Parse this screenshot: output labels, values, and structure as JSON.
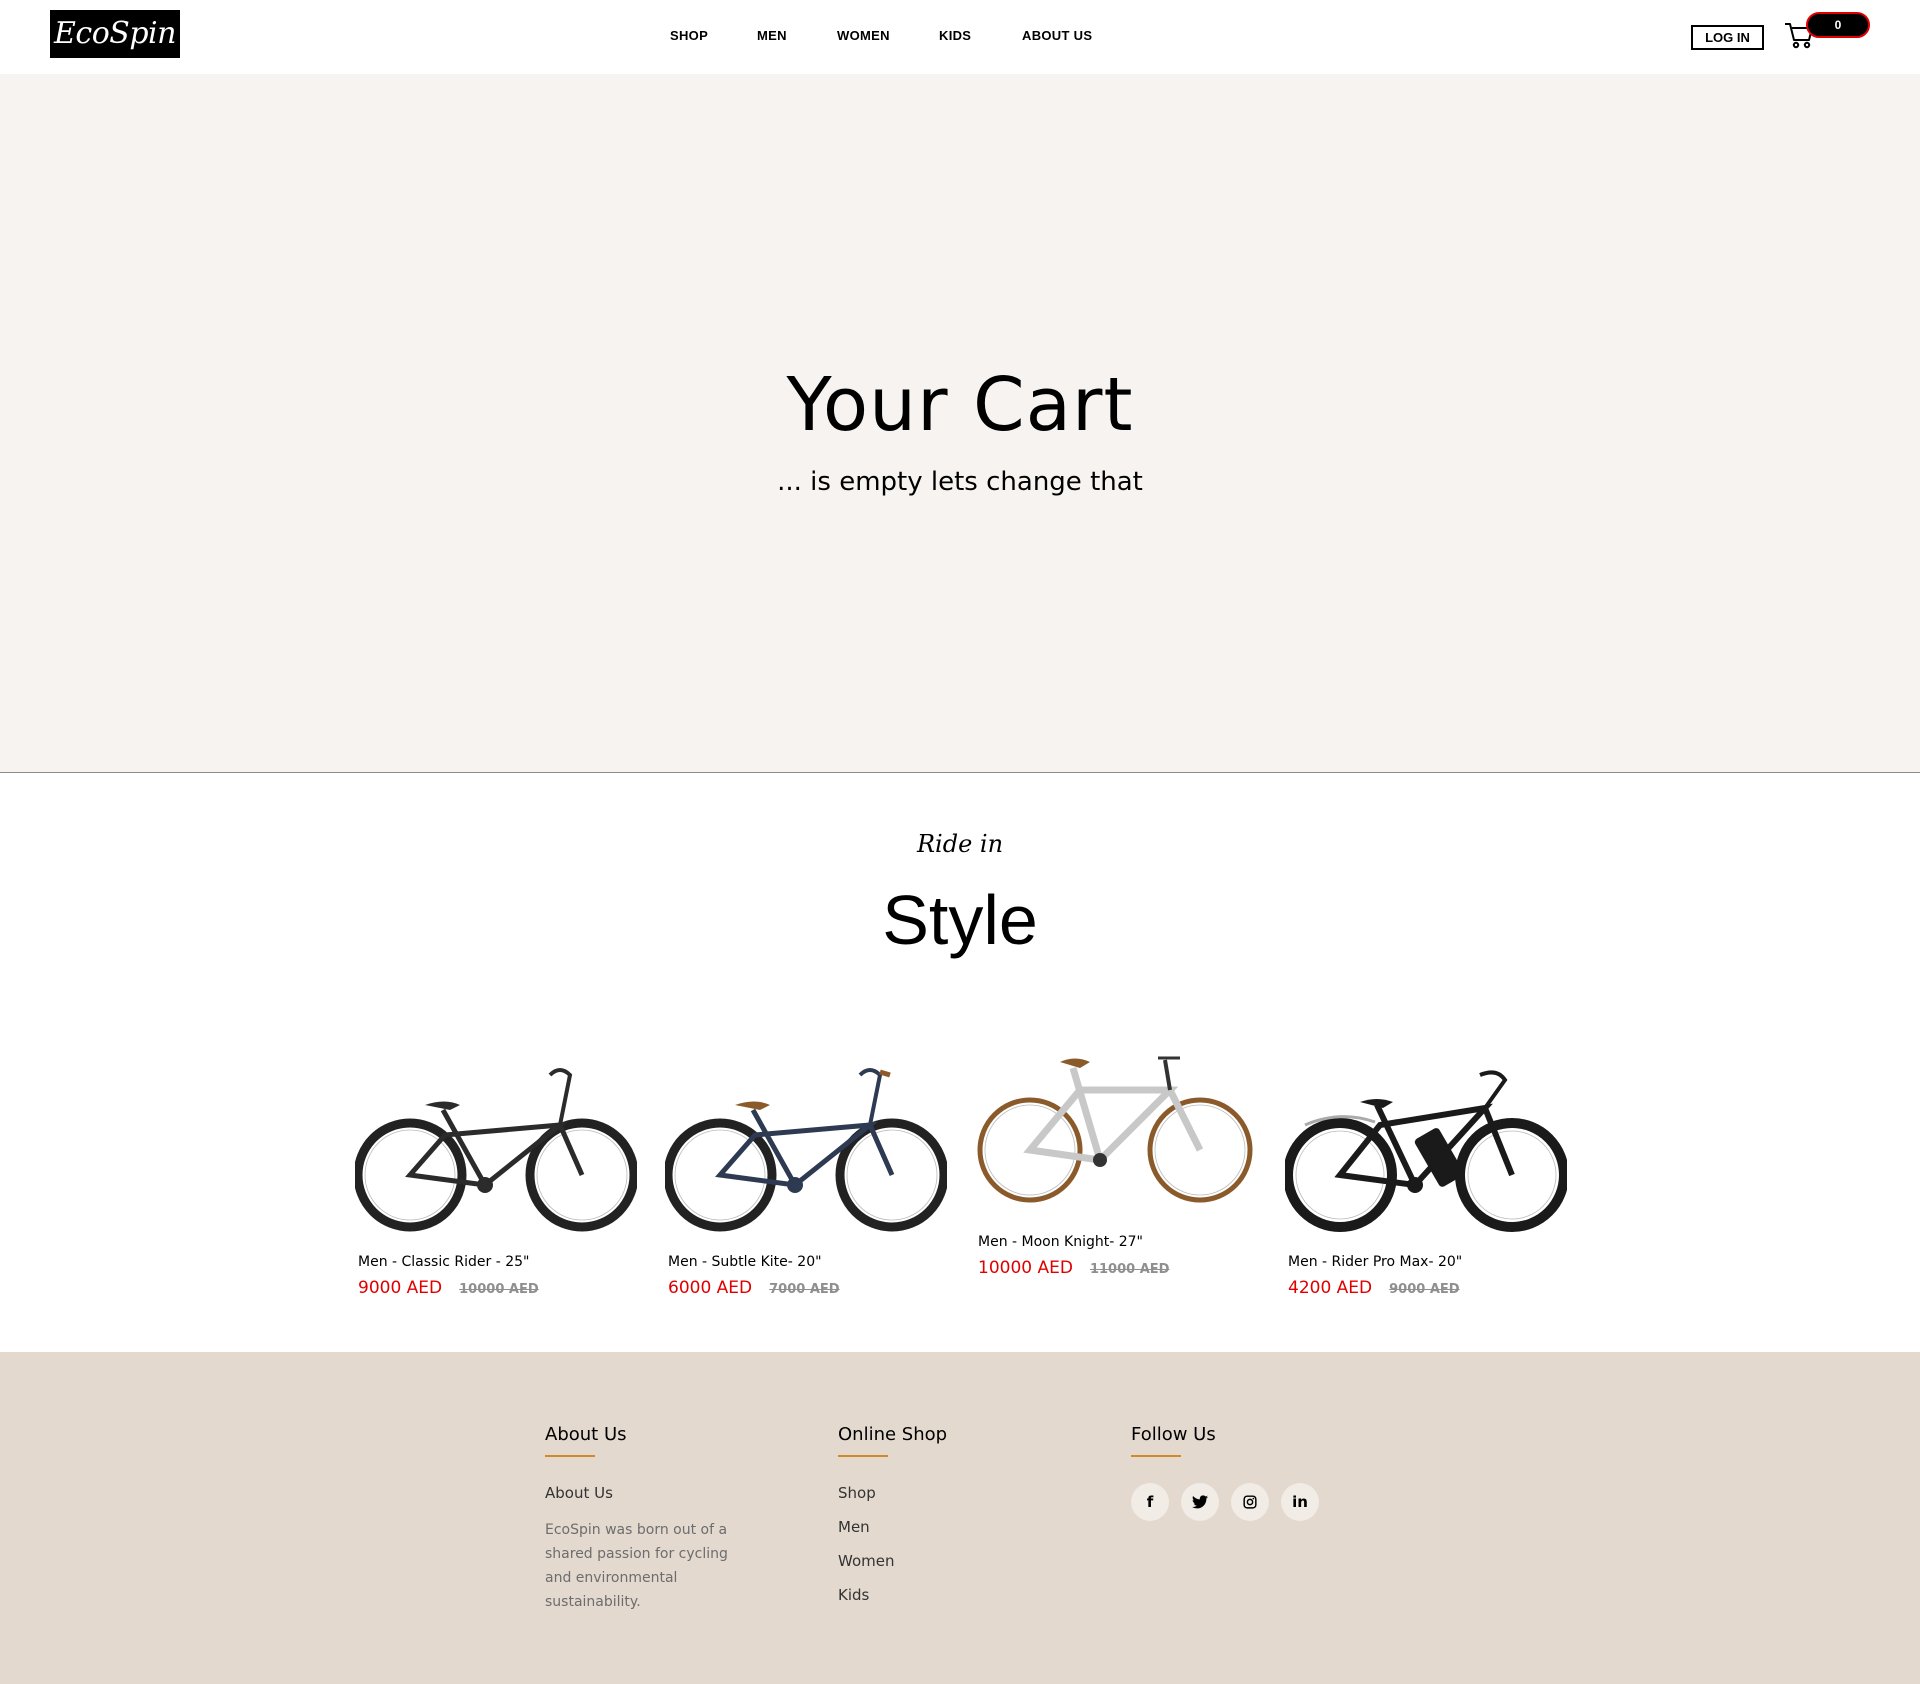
{
  "header": {
    "logo": "EcoSpin",
    "nav": [
      "SHOP",
      "MEN",
      "WOMEN",
      "KIDS",
      "ABOUT US"
    ],
    "login_label": "LOG IN",
    "cart_count": "0"
  },
  "hero": {
    "title": "Your Cart",
    "subtitle": "... is empty lets change that"
  },
  "section": {
    "kicker": "Ride in",
    "title": "Style"
  },
  "products": [
    {
      "name": "Men - Classic Rider - 25\"",
      "price": "9000 AED",
      "old_price": "10000 AED"
    },
    {
      "name": "Men - Subtle Kite- 20\"",
      "price": "6000 AED",
      "old_price": "7000 AED"
    },
    {
      "name": "Men - Moon Knight- 27\"",
      "price": "10000 AED",
      "old_price": "11000 AED"
    },
    {
      "name": "Men - Rider Pro Max- 20\"",
      "price": "4200 AED",
      "old_price": "9000 AED"
    }
  ],
  "footer": {
    "about": {
      "heading": "About Us",
      "link": "About Us",
      "description": "EcoSpin was born out of a shared passion for cycling and environmental sustainability."
    },
    "shop": {
      "heading": "Online Shop",
      "links": [
        "Shop",
        "Men",
        "Women",
        "Kids"
      ]
    },
    "follow": {
      "heading": "Follow Us",
      "icons": [
        "facebook-icon",
        "twitter-icon",
        "instagram-icon",
        "linkedin-icon"
      ]
    }
  },
  "colors": {
    "hero_bg": "#f6f3f0",
    "footer_bg": "#e3d9cf",
    "price_red": "#e00000",
    "accent_underline": "#d08a2a"
  }
}
